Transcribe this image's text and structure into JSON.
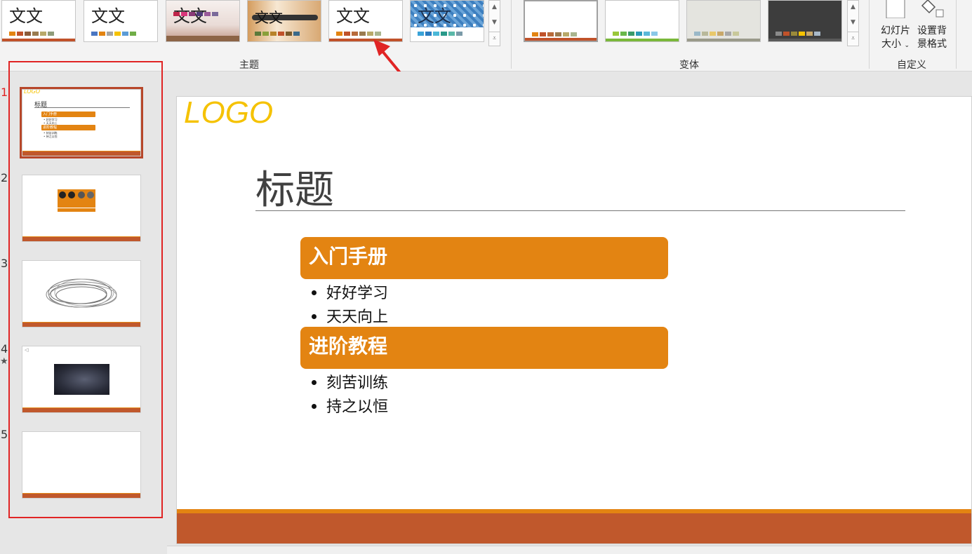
{
  "ribbon": {
    "themes_group_label": "主题",
    "variants_group_label": "变体",
    "customize_group_label": "自定义",
    "theme_sample_text": "文文",
    "themes": [
      {
        "name": "Theme 1",
        "swatches": [
          "#e38412",
          "#c0522a",
          "#8c5b3a",
          "#9a7b4f",
          "#b8a96a",
          "#8f9c7a"
        ]
      },
      {
        "name": "Theme 2",
        "swatches": [
          "#4a76c2",
          "#e38412",
          "#a5a5a5",
          "#f5c200",
          "#5b9bd5",
          "#70ad47"
        ]
      },
      {
        "name": "Theme 3",
        "swatches": [
          "#c0254a",
          "#d9367a",
          "#8a3a78",
          "#4f3b7a",
          "#9a5a9a",
          "#7a6a9a"
        ]
      },
      {
        "name": "Theme 4",
        "swatches": [
          "#5b7a3a",
          "#8aa03a",
          "#b8832a",
          "#c0522a",
          "#7a5a2a",
          "#3a6a8a"
        ]
      },
      {
        "name": "Theme 5",
        "swatches": [
          "#e38412",
          "#c0522a",
          "#b86a3a",
          "#9a7b4f",
          "#b8a96a",
          "#a9b58f"
        ]
      },
      {
        "name": "Theme 6",
        "swatches": [
          "#3aa3d8",
          "#2a7abf",
          "#4ab8d8",
          "#2a9a8a",
          "#5ab8a8",
          "#7a9aa8"
        ]
      }
    ],
    "variants": [
      {
        "name": "Variant 1",
        "swatches": [
          "#e38412",
          "#c0522a",
          "#b86a3a",
          "#9a7b4f",
          "#b8a96a",
          "#a9b58f"
        ]
      },
      {
        "name": "Variant 2",
        "swatches": [
          "#9ac83a",
          "#6ab84a",
          "#3a9a6a",
          "#2a9ab8",
          "#5ab8d8",
          "#8ac8e8"
        ]
      },
      {
        "name": "Variant 3",
        "swatches": [
          "#9ab8c8",
          "#b8b89a",
          "#e8c86a",
          "#c8a86a",
          "#a8a8a8",
          "#c8c89a"
        ]
      },
      {
        "name": "Variant 4",
        "swatches": [
          "#8a8a8a",
          "#c0522a",
          "#9a8a3a",
          "#f5c200",
          "#c8a86a",
          "#a8b8c8"
        ]
      }
    ],
    "slide_size_label_line1": "幻灯片",
    "slide_size_label_line2": "大小",
    "format_bg_label_line1": "设置背",
    "format_bg_label_line2": "景格式"
  },
  "thumbnails": [
    {
      "number": "1",
      "selected": true
    },
    {
      "number": "2",
      "selected": false
    },
    {
      "number": "3",
      "selected": false
    },
    {
      "number": "4",
      "selected": false
    },
    {
      "number": "5",
      "selected": false
    }
  ],
  "thumb1": {
    "logo": "LOGO",
    "title": "标题",
    "section1": "入门手册",
    "section2": "进阶教程",
    "b1": "好好学习",
    "b2": "天天向上",
    "b3": "刻苦训练",
    "b4": "持之以恒"
  },
  "slide": {
    "logo": "LOGO",
    "title": "标题",
    "sections": [
      {
        "heading": "入门手册",
        "bullets": [
          "好好学习",
          "天天向上"
        ]
      },
      {
        "heading": "进阶教程",
        "bullets": [
          "刻苦训练",
          "持之以恒"
        ]
      }
    ]
  },
  "colors": {
    "accent_orange": "#e38412",
    "footer_rust": "#c0582c",
    "logo_yellow": "#f5c200",
    "highlight_red": "#e02424"
  }
}
